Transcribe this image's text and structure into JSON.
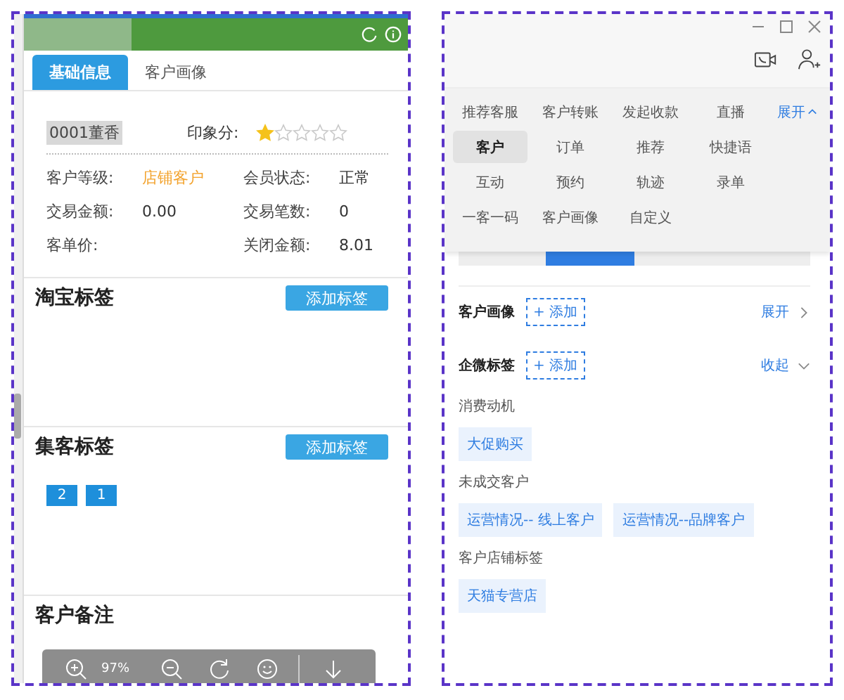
{
  "left": {
    "tabs": [
      {
        "label": "基础信息",
        "selected": true
      },
      {
        "label": "客户画像",
        "selected": false
      }
    ],
    "customer": {
      "name": "0001董香",
      "rating_label": "印象分:",
      "stars": 1
    },
    "fields": [
      {
        "label": "客户等级:",
        "value": "店铺客户",
        "color": "#f3a22b"
      },
      {
        "label": "会员状态:",
        "value": "正常"
      },
      {
        "label": "交易金额:",
        "value": "0.00"
      },
      {
        "label": "交易笔数:",
        "value": "0"
      },
      {
        "label": "客单价:"
      },
      {
        "label": "关闭金额:",
        "value": "8.01"
      }
    ],
    "sections": [
      {
        "title": "淘宝标签",
        "button": "添加标签"
      },
      {
        "title": "集客标签",
        "button": "添加标签",
        "tags": [
          "2",
          "1"
        ]
      },
      {
        "title": "客户备注"
      }
    ],
    "viewer_toolbar": {
      "zoom": "97%"
    }
  },
  "right": {
    "shortcuts": [
      [
        {
          "label": "推荐客服",
          "selected": false
        },
        {
          "label": "客户转账",
          "selected": false
        },
        {
          "label": "发起收款",
          "selected": false
        },
        {
          "label": "直播",
          "selected": false
        }
      ],
      [
        {
          "label": "客户",
          "selected": true
        },
        {
          "label": "订单",
          "selected": false
        },
        {
          "label": "推荐",
          "selected": false
        },
        {
          "label": "快捷语",
          "selected": false
        }
      ],
      [
        {
          "label": "互动",
          "selected": false
        },
        {
          "label": "预约",
          "selected": false
        },
        {
          "label": "轨迹",
          "selected": false
        },
        {
          "label": "录单",
          "selected": false
        }
      ],
      [
        {
          "label": "一客一码",
          "selected": false
        },
        {
          "label": "客户画像",
          "selected": false
        },
        {
          "label": "自定义",
          "selected": false
        }
      ]
    ],
    "shortcut_toggle": "展开",
    "tabs": [
      {
        "selected": false
      },
      {
        "selected": true
      },
      {
        "selected": false
      },
      {
        "selected": false
      }
    ],
    "sections": [
      {
        "title": "客户画像",
        "add": "+ 添加",
        "toggle": "展开",
        "expanded": false
      },
      {
        "title": "企微标签",
        "add": "+ 添加",
        "toggle": "收起",
        "expanded": true,
        "groups": [
          {
            "name": "消费动机",
            "tags": [
              "大促购买"
            ]
          },
          {
            "name": "未成交客户",
            "tags": [
              "运营情况-- 线上客户",
              "运营情况--品牌客户"
            ]
          },
          {
            "name": "客户店铺标签",
            "tags": [
              "天猫专营店"
            ]
          }
        ]
      }
    ]
  }
}
